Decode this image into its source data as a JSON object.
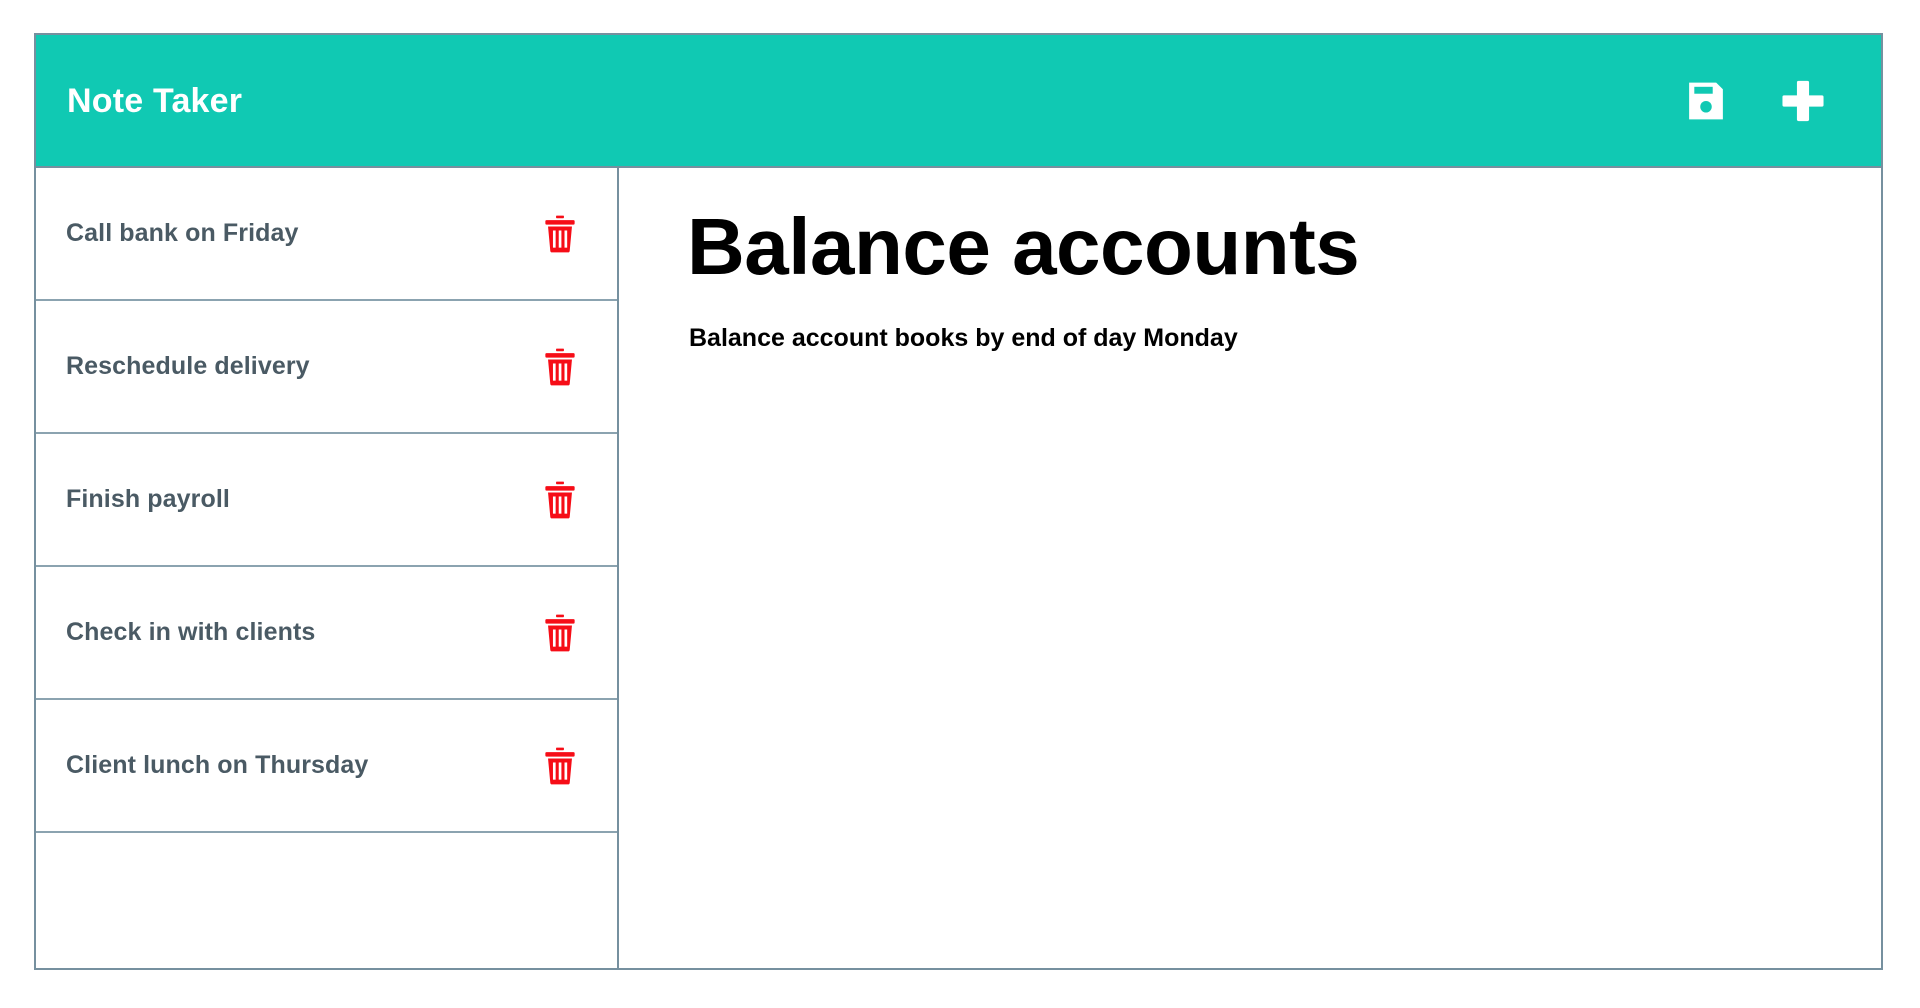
{
  "app": {
    "title": "Note Taker",
    "accent_color": "#10c9b3",
    "border_color": "#76909f",
    "note_text_color": "#4a5a64",
    "delete_icon_color": "#f60d17"
  },
  "header": {
    "title": "Note Taker",
    "actions": [
      {
        "name": "save-button",
        "icon": "save-icon",
        "label": "Save"
      },
      {
        "name": "add-note-button",
        "icon": "plus-icon",
        "label": "Add"
      }
    ]
  },
  "sidebar": {
    "notes": [
      {
        "title": "Call bank on Friday",
        "delete_icon": "trash-icon",
        "delete_label": "Delete"
      },
      {
        "title": "Reschedule delivery",
        "delete_icon": "trash-icon",
        "delete_label": "Delete"
      },
      {
        "title": "Finish payroll",
        "delete_icon": "trash-icon",
        "delete_label": "Delete"
      },
      {
        "title": "Check in with clients",
        "delete_icon": "trash-icon",
        "delete_label": "Delete"
      },
      {
        "title": "Client lunch on Thursday",
        "delete_icon": "trash-icon",
        "delete_label": "Delete"
      },
      {
        "title": "",
        "delete_icon": "",
        "delete_label": ""
      }
    ]
  },
  "detail": {
    "title": "Balance accounts",
    "body": "Balance account books by end of day Monday"
  }
}
